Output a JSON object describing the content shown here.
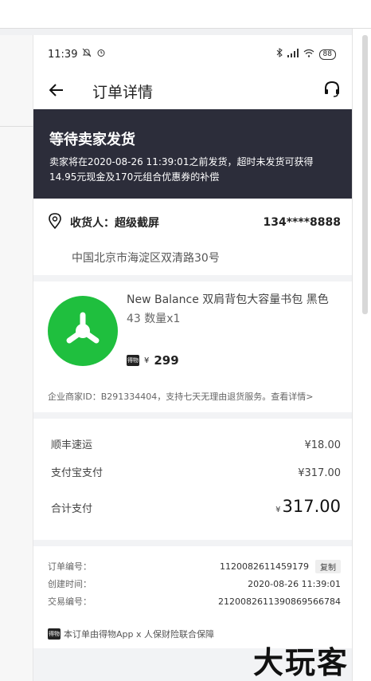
{
  "status_bar": {
    "time": "11:39",
    "battery": "88"
  },
  "nav": {
    "title": "订单详情"
  },
  "banner": {
    "title": "等待卖家发货",
    "line1": "卖家将在2020-08-26 11:39:01之前发货，超时未发货可获得",
    "line2": "14.95元现金及170元组合优惠券的补偿"
  },
  "address": {
    "name": "收货人：超级截屏",
    "phone": "134****8888",
    "detail": "中国北京市海淀区双清路30号"
  },
  "product": {
    "name": "New Balance 双肩背包大容量书包 黑色",
    "spec": "43  数量x1",
    "badge": "得物",
    "currency": "¥",
    "price": "299",
    "note": "企业商家ID：B291334404，支持七天无理由退货服务。查看详情>"
  },
  "payment": {
    "rows": [
      {
        "label": "顺丰速运",
        "value": "¥18.00"
      },
      {
        "label": "支付宝支付",
        "value": "¥317.00"
      }
    ],
    "total_label": "合计支付",
    "total_currency": "¥",
    "total_value": "317.00"
  },
  "order_info": {
    "rows": [
      {
        "label": "订单编号：",
        "value": "1120082611459179"
      },
      {
        "label": "创建时间：",
        "value": "2020-08-26 11:39:01"
      },
      {
        "label": "交易编号：",
        "value": "2120082611390869566784"
      }
    ],
    "copy_label": "复制",
    "footer": "本订单由得物App x 人保财险联合保障"
  },
  "watermark": "大玩客",
  "colors": {
    "banner_bg": "#2c2d3a",
    "product_icon": "#1fbf3e"
  }
}
